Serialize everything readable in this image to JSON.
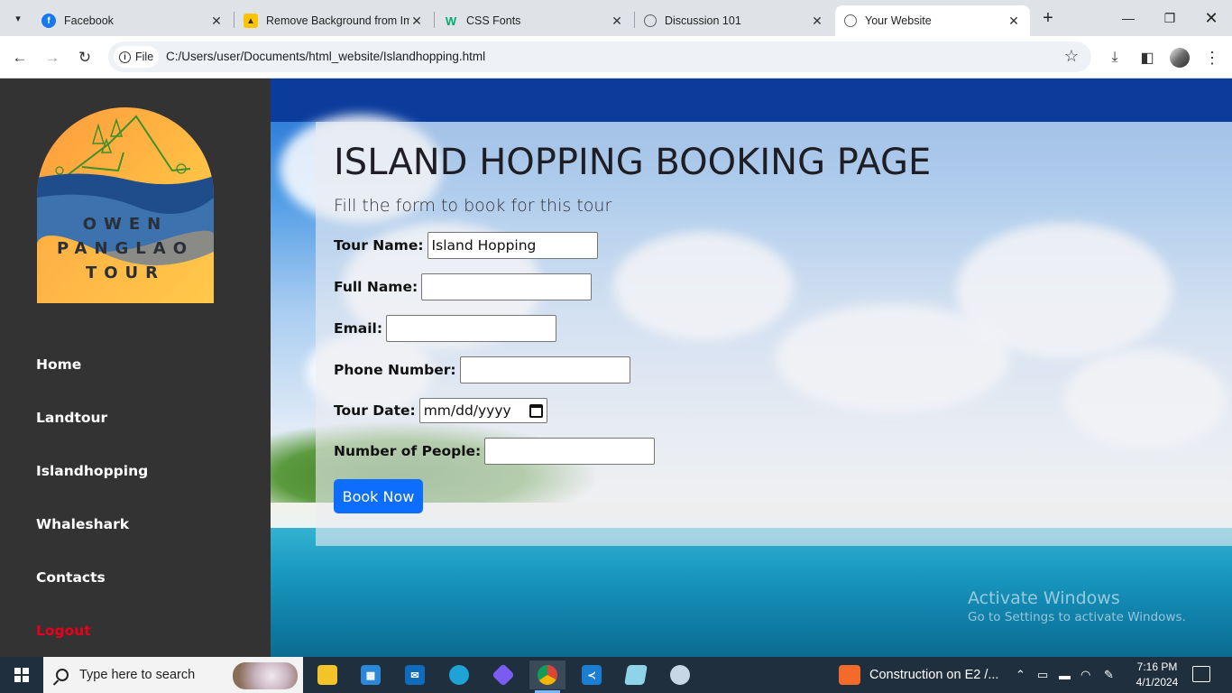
{
  "browser": {
    "tabs": [
      {
        "label": "Facebook",
        "icon": "facebook-icon",
        "color": "#1877f2",
        "active": false
      },
      {
        "label": "Remove Background from Im",
        "icon": "removebg-icon",
        "color": "#ffc400",
        "active": false
      },
      {
        "label": "CSS Fonts",
        "icon": "w3schools-icon",
        "color": "#04aa6d",
        "active": false
      },
      {
        "label": "Discussion 101",
        "icon": "globe-icon",
        "color": "#5f6368",
        "active": false
      },
      {
        "label": "Your Website",
        "icon": "globe-icon",
        "color": "#5f6368",
        "active": true
      }
    ],
    "chip_label": "File",
    "url": "C:/Users/user/Documents/html_website/Islandhopping.html"
  },
  "sidebar": {
    "logo": {
      "line1": "OWEN",
      "line2": "PANGLAO",
      "line3": "TOUR"
    },
    "nav": [
      {
        "label": "Home"
      },
      {
        "label": "Landtour"
      },
      {
        "label": "Islandhopping"
      },
      {
        "label": "Whaleshark"
      },
      {
        "label": "Contacts"
      },
      {
        "label": "Logout"
      }
    ]
  },
  "main": {
    "title": "ISLAND HOPPING BOOKING PAGE",
    "subtitle": "Fill the form to book for this tour",
    "form": {
      "tour_name": {
        "label": "Tour Name:",
        "value": "Island Hopping"
      },
      "full_name": {
        "label": "Full Name:",
        "value": ""
      },
      "email": {
        "label": "Email:",
        "value": ""
      },
      "phone": {
        "label": "Phone Number:",
        "value": ""
      },
      "tour_date": {
        "label": "Tour Date:",
        "placeholder": "mm/dd/yyyy"
      },
      "people": {
        "label": "Number of People:",
        "value": ""
      },
      "submit_label": "Book Now"
    },
    "watermark": {
      "line1": "Activate Windows",
      "line2": "Go to Settings to activate Windows."
    }
  },
  "taskbar": {
    "search_placeholder": "Type here to search",
    "apps": [
      "file-explorer-icon",
      "microsoft-store-icon",
      "mail-icon",
      "edge-icon",
      "copilot-icon",
      "chrome-icon",
      "vscode-icon",
      "notepad-icon",
      "paint-icon"
    ],
    "weather_text": "Construction on E2 /...",
    "time": "7:16 PM",
    "date": "4/1/2024"
  },
  "colors": {
    "sidebar_bg": "#333333",
    "logout": "#e8001c",
    "button": "#0d6efd"
  }
}
